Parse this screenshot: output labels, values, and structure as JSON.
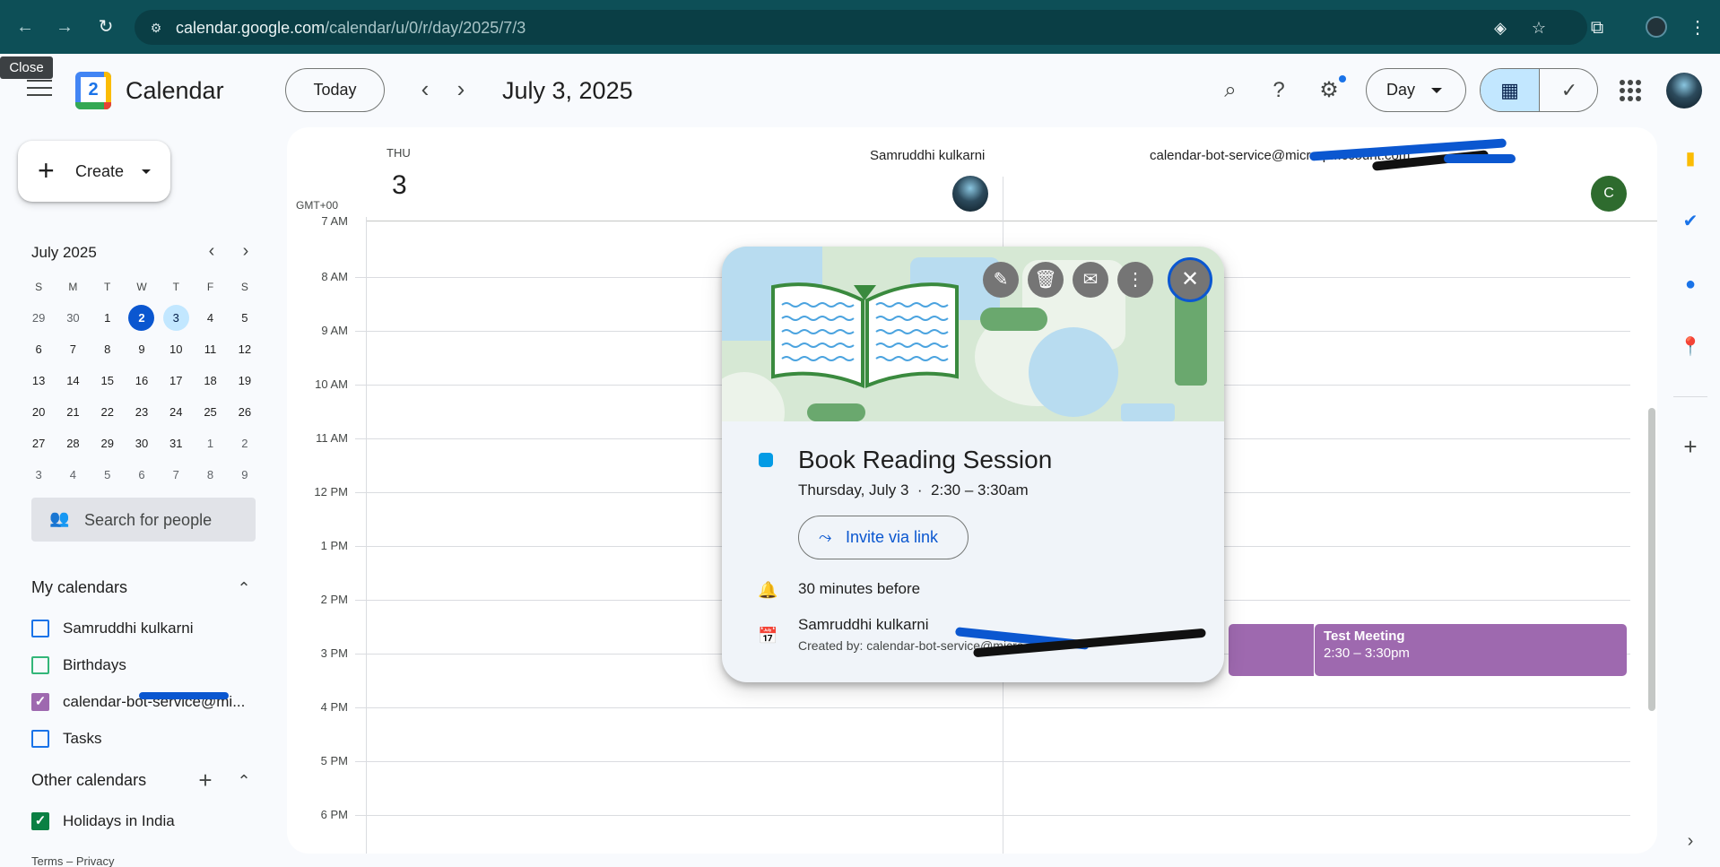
{
  "browser": {
    "url_host": "calendar.google.com",
    "url_path": "/calendar/u/0/r/day/2025/7/3",
    "tooltip": "Close"
  },
  "header": {
    "app_title": "Calendar",
    "logo_day": "2",
    "today_label": "Today",
    "date_title": "July 3, 2025",
    "view_label": "Day"
  },
  "sidebar": {
    "create_label": "Create",
    "mini_calendar": {
      "title": "July 2025",
      "weekdays": [
        "S",
        "M",
        "T",
        "W",
        "T",
        "F",
        "S"
      ],
      "weeks": [
        [
          "29",
          "30",
          "1",
          "2",
          "3",
          "4",
          "5"
        ],
        [
          "6",
          "7",
          "8",
          "9",
          "10",
          "11",
          "12"
        ],
        [
          "13",
          "14",
          "15",
          "16",
          "17",
          "18",
          "19"
        ],
        [
          "20",
          "21",
          "22",
          "23",
          "24",
          "25",
          "26"
        ],
        [
          "27",
          "28",
          "29",
          "30",
          "31",
          "1",
          "2"
        ],
        [
          "3",
          "4",
          "5",
          "6",
          "7",
          "8",
          "9"
        ]
      ],
      "today": "2",
      "selected": "3"
    },
    "search_people_placeholder": "Search for people",
    "my_calendars_title": "My calendars",
    "my_calendars": [
      {
        "name": "Samruddhi kulkarni",
        "color": "#1a73e8",
        "checked": false
      },
      {
        "name": "Birthdays",
        "color": "#33b679",
        "checked": false
      },
      {
        "name": "calendar-bot-service@mi...",
        "color": "#9e69af",
        "checked": true
      },
      {
        "name": "Tasks",
        "color": "#1a73e8",
        "checked": false
      }
    ],
    "other_calendars_title": "Other calendars",
    "other_calendars": [
      {
        "name": "Holidays in India",
        "color": "#0b8043",
        "checked": true
      }
    ],
    "footer": "Terms – Privacy"
  },
  "day_view": {
    "day_name": "THU",
    "day_number": "3",
    "timezone": "GMT+00",
    "people": [
      {
        "name": "Samruddhi kulkarni"
      },
      {
        "name": "calendar-bot-service@micro-p...ccount.com",
        "initial": "C"
      }
    ],
    "hours": [
      "7 AM",
      "8 AM",
      "9 AM",
      "10 AM",
      "11 AM",
      "12 PM",
      "1 PM",
      "2 PM",
      "3 PM",
      "4 PM",
      "5 PM",
      "6 PM"
    ],
    "events": [
      {
        "title": "Test Meeting",
        "time": "2:30 – 3:30pm",
        "color": "#9e69af"
      }
    ]
  },
  "popup": {
    "title": "Book Reading Session",
    "when": "Thursday, July 3  ·  2:30 – 3:30am",
    "invite_label": "Invite via link",
    "reminder": "30 minutes before",
    "calendar_name": "Samruddhi kulkarni",
    "created_by": "Created by: calendar-bot-service@micro...9.i...",
    "event_color": "#039be5"
  }
}
